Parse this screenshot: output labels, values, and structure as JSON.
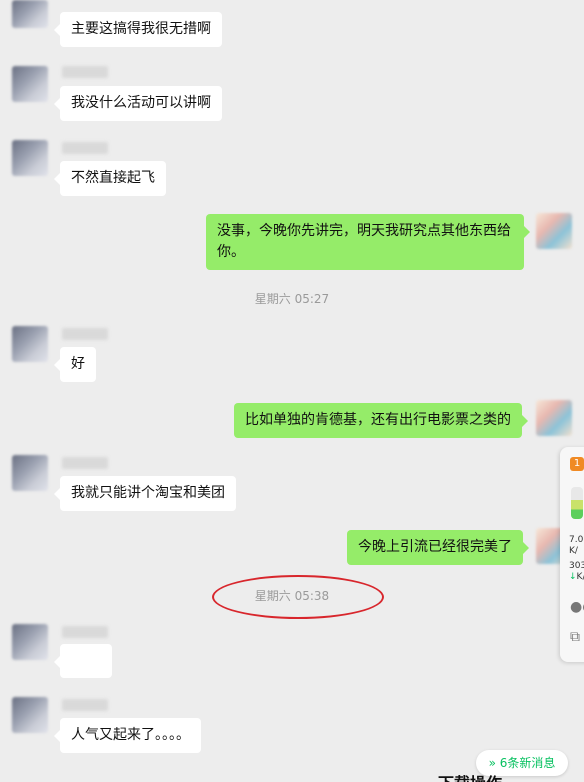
{
  "messages": [
    {
      "side": "in",
      "text": "主要这搞得我很无措啊"
    },
    {
      "side": "in",
      "text": "我没什么活动可以讲啊"
    },
    {
      "side": "in",
      "text": "不然直接起飞"
    },
    {
      "side": "out",
      "text_line1": "没事，今晚你先讲完，明天我研究点其他东西给",
      "text_line2": "你。"
    },
    {
      "side": "in",
      "text": "好"
    },
    {
      "side": "out",
      "text": "比如单独的肯德基，还有出行电影票之类的"
    },
    {
      "side": "in",
      "text": "我就只能讲个淘宝和美团"
    },
    {
      "side": "out",
      "text": "今晚上引流已经很完美了"
    },
    {
      "side": "in",
      "text": "人气又起来了。。。。"
    }
  ],
  "timestamps": [
    "星期六 05:27",
    "星期六 05:38"
  ],
  "side_panel": {
    "badge": "1",
    "speed_up": "7.0",
    "speed_up_unit": "K/",
    "speed_down": "303",
    "speed_down_unit": "K/"
  },
  "new_messages_button": {
    "icon": "double-chevron-down-icon",
    "label": "6条新消息"
  },
  "bottom_partial_text": "下载操作",
  "colors": {
    "incoming_bubble": "#ffffff",
    "outgoing_bubble": "#95ec69",
    "background": "#ededed",
    "annotation_circle": "#d8262c",
    "new_messages_text": "#07c160"
  }
}
